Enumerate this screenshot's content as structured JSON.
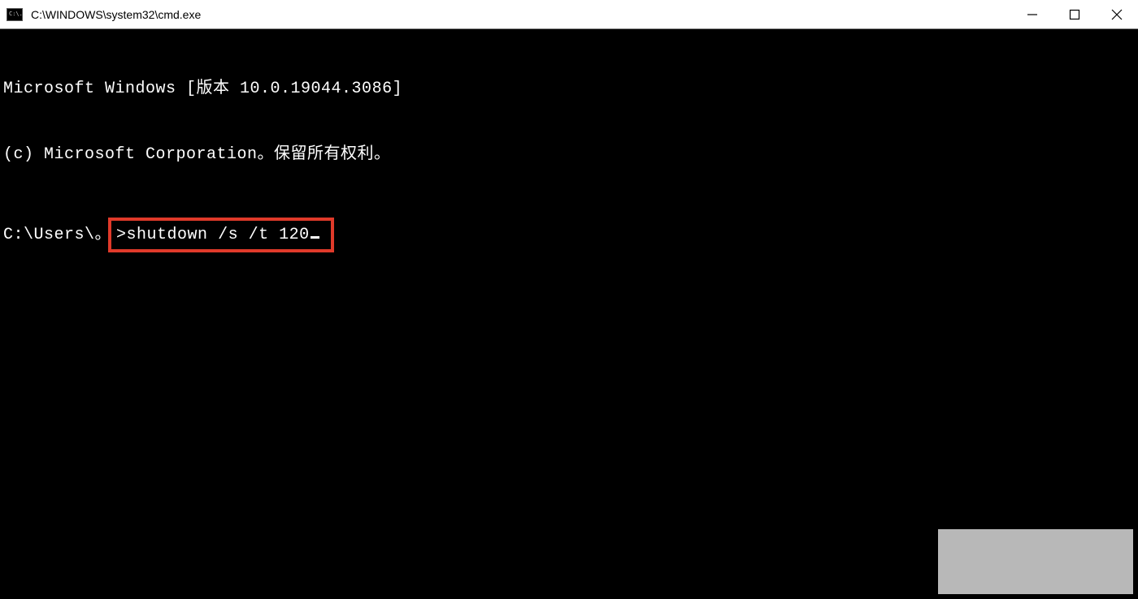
{
  "window": {
    "title": "C:\\WINDOWS\\system32\\cmd.exe",
    "icon_label": "C:\\."
  },
  "terminal": {
    "line1": "Microsoft Windows [版本 10.0.19044.3086]",
    "line2": "(c) Microsoft Corporation。保留所有权利。",
    "prompt_prefix": "C:\\Users\\。",
    "prompt_symbol": ">",
    "command": "shutdown /s /t 120"
  }
}
